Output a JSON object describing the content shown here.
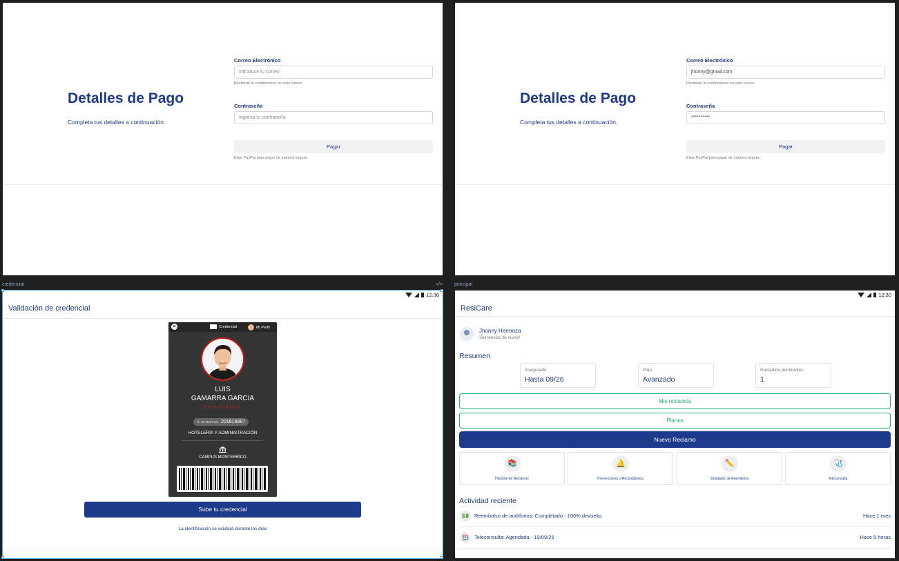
{
  "payment_before": {
    "title": "Detalles de Pago",
    "subtitle": "Completa tus detalles a continuación.",
    "email_label": "Correo Electrónico",
    "email_placeholder": "Introduce tu correo",
    "email_help": "Recibirás la confirmación en este correo.",
    "password_label": "Contraseña",
    "password_placeholder": "Ingresa tu contraseña",
    "pay_button": "Pagar",
    "pay_note": "Elige PayPal para pagar de manera segura."
  },
  "payment_after": {
    "title": "Detalles de Pago",
    "subtitle": "Completa tus detalles a continuación.",
    "email_label": "Correo Electrónico",
    "email_value": "jhonny@gmail.com",
    "email_help": "Recibirás la confirmación en este correo.",
    "password_label": "Contraseña",
    "password_value": "**********",
    "pay_button": "Pagar",
    "pay_note": "Elige PayPal para pagar de manera segura."
  },
  "frame_labels": {
    "credencial": "credencial",
    "principal": "principal",
    "code_icon": "</>"
  },
  "status_bar": {
    "time": "12:30"
  },
  "credencial": {
    "header": "Validación de credencial",
    "card": {
      "tab_credencial": "Credencial",
      "tab_perfil": "Mi Perfil",
      "first_name": "LUIS",
      "last_name": "GAMARRA GARCIA",
      "role": "ESTUDIANTE",
      "matricula_label": "N° de Matrícula",
      "matricula_number": "201616867",
      "career": "HOTELERÍA Y ADMINISTRACIÓN",
      "campus": "CAMPUS MONTERRICO"
    },
    "upload_button": "Sube tu credencial",
    "note": "La identificación se validará durante los días"
  },
  "principal": {
    "app_title": "ResiCare",
    "user_name": "Jhonny Hermoza",
    "welcome": "¡Bienvenido de nuevo!",
    "summary_title": "Resumen",
    "stats": [
      {
        "label": "Asegurado",
        "value": "Hasta 09/26"
      },
      {
        "label": "Plan",
        "value": "Avanzado"
      },
      {
        "label": "Reclamos pendientes",
        "value": "1"
      }
    ],
    "btn_mis_reclamos": "Mis reclamos",
    "btn_planes": "Planes",
    "btn_nuevo_reclamo": "Nuevo Reclamo",
    "tiles": [
      {
        "label": "Historial de Reclamos",
        "icon": "books-icon"
      },
      {
        "label": "Prevenciones y Recordatorios",
        "icon": "bell-icon"
      },
      {
        "label": "Simulador de Reembolso",
        "icon": "pencil-icon"
      },
      {
        "label": "Teleconsulta",
        "icon": "stethoscope-icon"
      }
    ],
    "activity_title": "Actividad reciente",
    "activity": [
      {
        "text": "Reembolso de audífonos: Completado - 100% devuelto",
        "time": "Hace 1 mes",
        "icon": "money-icon"
      },
      {
        "text": "Teleconsulta: Agendada - 19/09/25",
        "time": "Hace 5 horas",
        "icon": "hospital-icon"
      }
    ]
  },
  "colors": {
    "brand_blue": "#1e3a8a",
    "accent_green": "#21b07a",
    "card_dark": "#353535",
    "card_red": "#d01919"
  }
}
